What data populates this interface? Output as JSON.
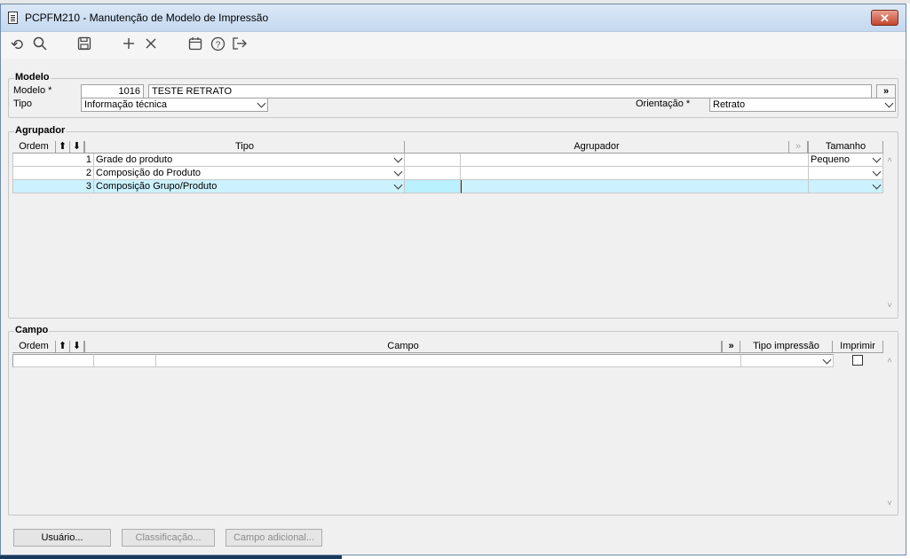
{
  "window": {
    "title": "PCPFM210 - Manutenção de Modelo de Impressão",
    "close_label": "✕"
  },
  "toolbar": {
    "icons": [
      "undo-icon",
      "search-icon",
      "save-icon",
      "add-icon",
      "delete-icon",
      "calendar-icon",
      "help-icon",
      "exit-icon"
    ]
  },
  "modelo": {
    "section_title": "Modelo",
    "modelo_label": "Modelo *",
    "modelo_code": "1016",
    "modelo_desc": "TESTE RETRATO",
    "more_button": "»",
    "tipo_label": "Tipo",
    "tipo_value": "Informação técnica",
    "orientacao_label": "Orientação *",
    "orientacao_value": "Retrato"
  },
  "agrupador": {
    "section_title": "Agrupador",
    "headers": {
      "ordem": "Ordem",
      "tipo": "Tipo",
      "agrupador": "Agrupador",
      "more": "»",
      "tamanho": "Tamanho"
    },
    "rows": [
      {
        "ordem": "1",
        "tipo": "Grade do produto",
        "code": "",
        "agrupador": "",
        "tamanho": "Pequeno"
      },
      {
        "ordem": "2",
        "tipo": "Composição do Produto",
        "code": "",
        "agrupador": "",
        "tamanho": ""
      },
      {
        "ordem": "3",
        "tipo": "Composição Grupo/Produto",
        "code": "",
        "agrupador": "",
        "tamanho": ""
      }
    ]
  },
  "campo": {
    "section_title": "Campo",
    "headers": {
      "ordem": "Ordem",
      "campo": "Campo",
      "more": "»",
      "tipo_impressao": "Tipo impressão",
      "imprimir": "Imprimir"
    }
  },
  "buttons": {
    "usuario": "Usuário...",
    "classificacao": "Classificação...",
    "campo_adicional": "Campo adicional..."
  }
}
